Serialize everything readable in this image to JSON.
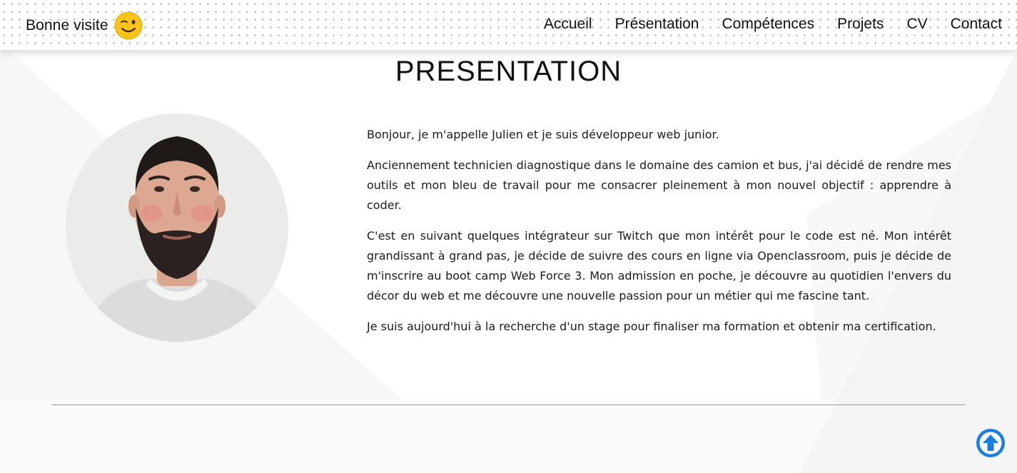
{
  "header": {
    "brand_text": "Bonne visite",
    "brand_emoji_icon": "winking-face-icon"
  },
  "nav": {
    "items": [
      {
        "label": "Accueil"
      },
      {
        "label": "Présentation"
      },
      {
        "label": "Compétences"
      },
      {
        "label": "Projets"
      },
      {
        "label": "CV"
      },
      {
        "label": "Contact"
      }
    ]
  },
  "main": {
    "title": "PRESENTATION",
    "avatar_icon": "profile-photo",
    "paragraphs": [
      "Bonjour, je m'appelle Julien et je suis développeur web junior.",
      "Anciennement technicien diagnostique dans le domaine des camion et bus, j'ai décidé de rendre mes outils et mon bleu de travail pour me consacrer pleinement à mon nouvel objectif : apprendre à coder.",
      "C'est en suivant quelques intégrateur sur Twitch que mon intérêt pour le code est né. Mon intérêt grandissant à grand pas, je décide de suivre des cours en ligne via Openclassroom, puis je décide de m'inscrire au boot camp Web Force 3. Mon admission en poche, je découvre au quotidien l'envers du décor du web et me découvre une nouvelle passion pour un métier qui me fascine tant.",
      "Je suis aujourd'hui à la recherche d'un stage pour finaliser ma formation et obtenir ma certification."
    ]
  },
  "scroll_top": {
    "icon": "arrow-up-circle-icon",
    "color": "#1a7de0"
  },
  "colors": {
    "text": "#111111",
    "divider": "#9c9c9c",
    "background_shape": "#f4f4f4"
  }
}
